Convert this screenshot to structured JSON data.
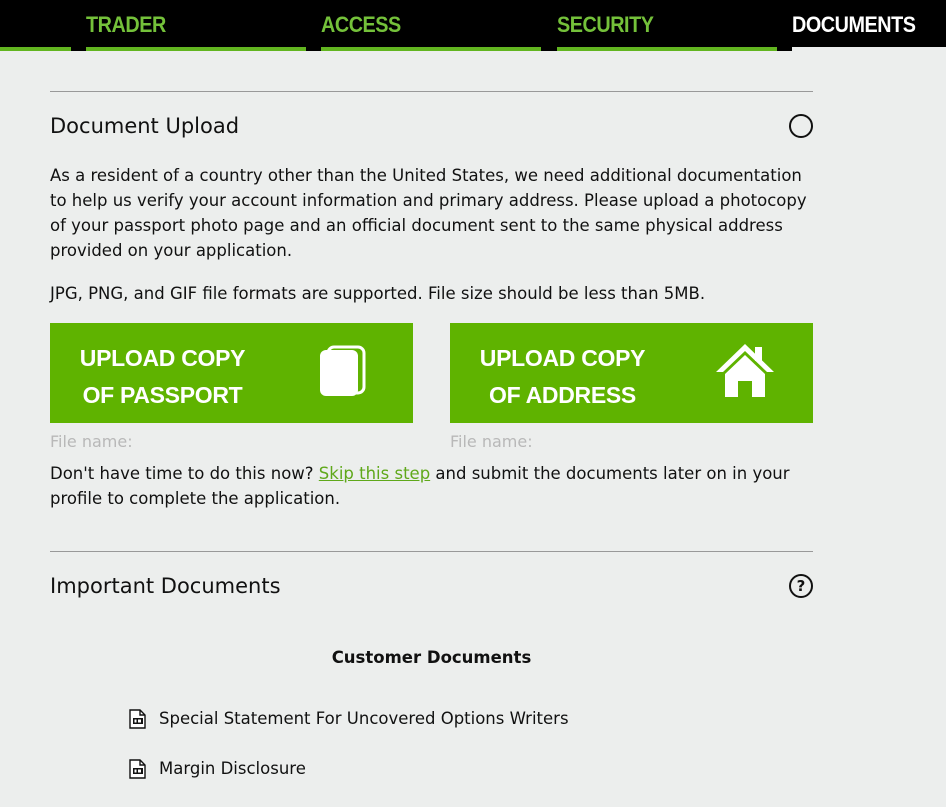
{
  "tabs": [
    {
      "label": "TRADER",
      "active": false
    },
    {
      "label": "ACCESS",
      "active": false
    },
    {
      "label": "SECURITY",
      "active": false
    },
    {
      "label": "DOCUMENTS",
      "active": true
    }
  ],
  "document_upload": {
    "title": "Document Upload",
    "status_icon": "circle-outline-icon",
    "description": "As a resident of a country other than the United States, we need additional documentation to help us verify your account information and primary address. Please upload a photocopy of your passport photo page and an official document sent to the same physical address provided on your application.",
    "formats_note": "JPG, PNG, and GIF file formats are supported. File size should be less than 5MB.",
    "passport_button": {
      "line1": "UPLOAD COPY",
      "line2": "OF PASSPORT",
      "icon": "document-copy-icon"
    },
    "address_button": {
      "line1": "UPLOAD COPY",
      "line2": "OF ADDRESS",
      "icon": "home-icon"
    },
    "passport_file_label": "File name:",
    "address_file_label": "File name:",
    "skip_prefix": "Don't have time to do this now?",
    "skip_link": "Skip this step",
    "skip_suffix": "and submit the documents later on in your profile to complete the application."
  },
  "important_documents": {
    "title": "Important Documents",
    "help_icon": "?",
    "customer_heading": "Customer Documents",
    "items": [
      {
        "label": "Special Statement For Uncovered Options Writers",
        "icon": "pdf-file-icon"
      },
      {
        "label": "Margin Disclosure",
        "icon": "pdf-file-icon"
      }
    ]
  },
  "colors": {
    "accent_green": "#5fb300",
    "tab_text_green": "#74c13a",
    "link_green": "#5fa81a",
    "background": "#eceeed",
    "tabbar": "#000000"
  }
}
